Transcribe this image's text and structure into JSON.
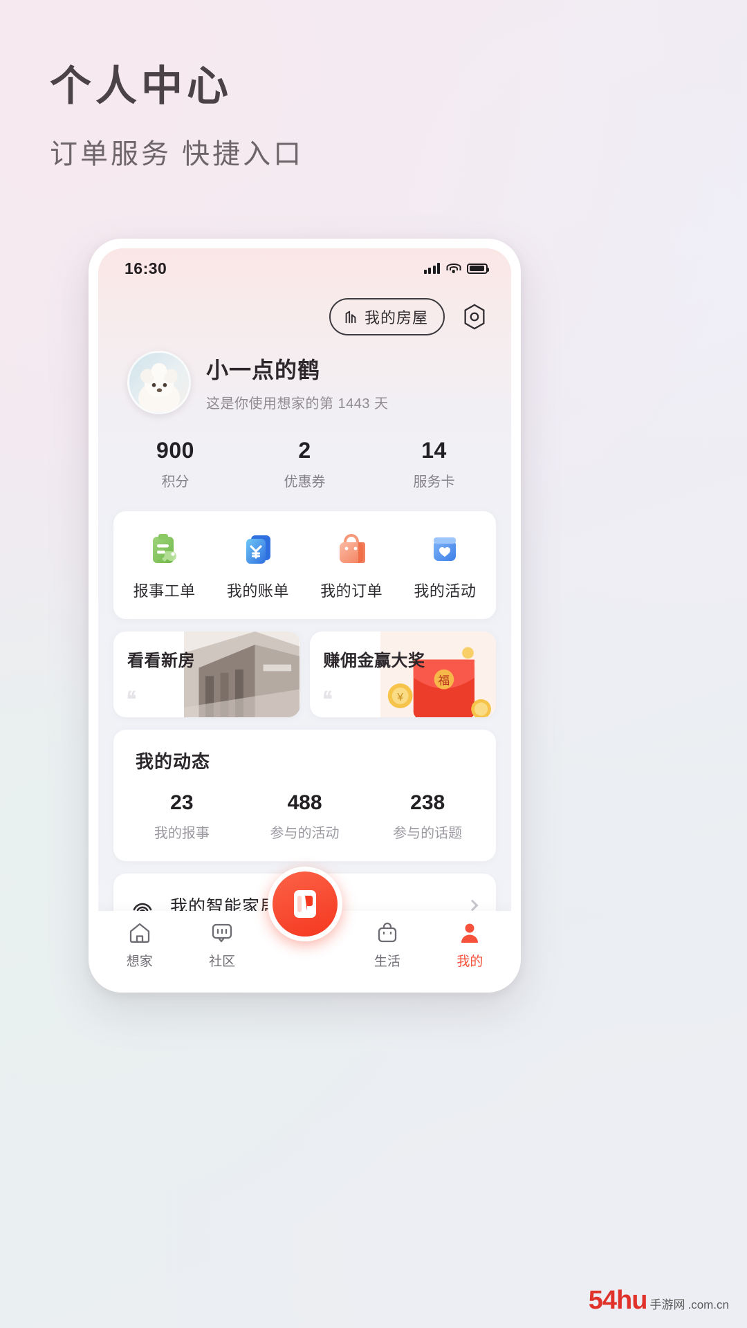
{
  "page": {
    "title": "个人中心",
    "subtitle": "订单服务 快捷入口"
  },
  "statusbar": {
    "time": "16:30",
    "signal_icon": "signal-bars-icon",
    "wifi_icon": "wifi-icon",
    "battery_icon": "battery-icon"
  },
  "header": {
    "house_button": "我的房屋",
    "house_icon": "building-icon",
    "settings_icon": "settings-gear-icon"
  },
  "profile": {
    "avatar_icon": "user-avatar",
    "name": "小一点的鹤",
    "days_text": "这是你使用想家的第 1443 天"
  },
  "stats": [
    {
      "value": "900",
      "label": "积分"
    },
    {
      "value": "2",
      "label": "优惠券"
    },
    {
      "value": "14",
      "label": "服务卡"
    }
  ],
  "quick_actions": [
    {
      "label": "报事工单",
      "icon": "clipboard-wrench-icon",
      "color": "#7cc05a"
    },
    {
      "label": "我的账单",
      "icon": "yen-card-icon",
      "color": "#2f7ced"
    },
    {
      "label": "我的订单",
      "icon": "shopping-bag-icon",
      "color": "#f78a6c"
    },
    {
      "label": "我的活动",
      "icon": "heart-box-icon",
      "color": "#4e8ff2"
    }
  ],
  "banners": [
    {
      "title": "看看新房",
      "art": "building-photo"
    },
    {
      "title": "赚佣金赢大奖",
      "art": "red-packet-coins"
    }
  ],
  "dynamic": {
    "title": "我的动态",
    "items": [
      {
        "value": "23",
        "label": "我的报事"
      },
      {
        "value": "488",
        "label": "参与的活动"
      },
      {
        "value": "238",
        "label": "参与的话题"
      }
    ]
  },
  "rows": [
    {
      "label": "我的智能家居",
      "icon": "smart-home-icon",
      "chevron": "chevron-right-icon"
    }
  ],
  "tabbar": {
    "items": [
      {
        "label": "想家",
        "icon": "home-icon",
        "active": false
      },
      {
        "label": "社区",
        "icon": "community-icon",
        "active": false
      },
      {
        "label": "生活",
        "icon": "life-bag-icon",
        "active": false
      },
      {
        "label": "我的",
        "icon": "person-icon",
        "active": true
      }
    ],
    "fab_icon": "book-fab-icon"
  },
  "watermark": {
    "big": "54hu",
    "small": "手游网",
    "domain": ".com.cn"
  },
  "colors": {
    "accent": "#f5513b",
    "fab": "#f4371f",
    "text_dark": "#2b272b",
    "text_muted": "#8e8a90"
  }
}
